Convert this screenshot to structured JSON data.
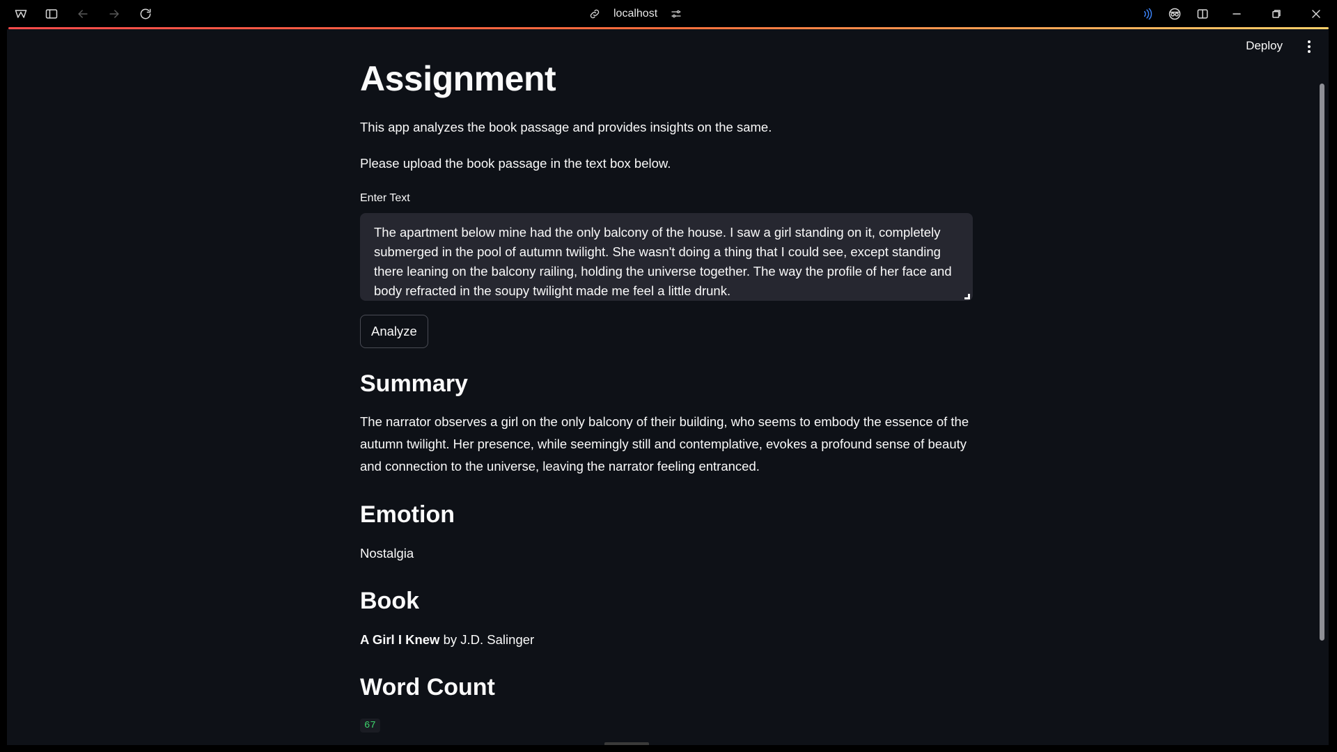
{
  "browser": {
    "address": "localhost"
  },
  "app": {
    "deploy_label": "Deploy",
    "title": "Assignment",
    "intro": "This app analyzes the book passage and provides insights on the same.",
    "instruction": "Please upload the book passage in the text box below.",
    "input_label": "Enter Text",
    "input_value": "The apartment below mine had the only balcony of the house. I saw a girl standing on it, completely submerged in the pool of autumn twilight. She wasn't doing a thing that I could see, except standing there leaning on the balcony railing, holding the universe together. The way the profile of her face and body refracted in the soupy twilight made me feel a little drunk.",
    "analyze_label": "Analyze",
    "summary_heading": "Summary",
    "summary_text": "The narrator observes a girl on the only balcony of their building, who seems to embody the essence of the autumn twilight. Her presence, while seemingly still and contemplative, evokes a profound sense of beauty and connection to the universe, leaving the narrator feeling entranced.",
    "emotion_heading": "Emotion",
    "emotion_value": "Nostalgia",
    "book_heading": "Book",
    "book_title": "A Girl I Knew",
    "book_author": " by J.D. Salinger",
    "wordcount_heading": "Word Count",
    "wordcount_value": "67"
  },
  "colors": {
    "background": "#0e1117",
    "input_bg": "#262730",
    "accent": "#ff4b4b",
    "code_green": "#3dd56d"
  }
}
